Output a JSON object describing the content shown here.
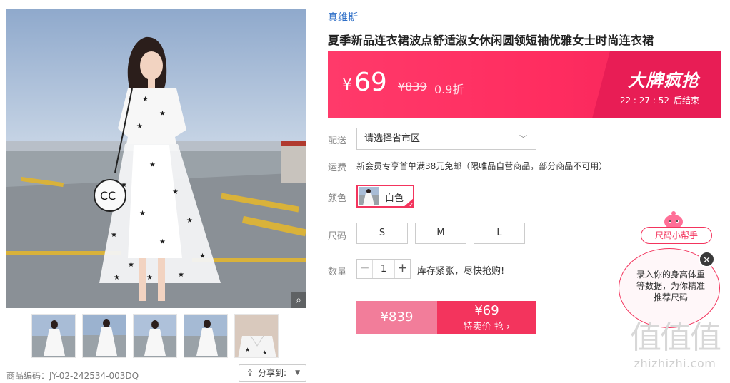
{
  "product": {
    "brand": "真维斯",
    "title": "夏季新品连衣裙波点舒适淑女休闲圆领短袖优雅女士时尚连衣裙",
    "sku_line": "商品编码：JY-02-242534-003DQ",
    "share_label": "分享到:",
    "zoom_icon": "magnifier-icon"
  },
  "thumbnails": [
    {
      "label": "thumb-1"
    },
    {
      "label": "thumb-2"
    },
    {
      "label": "thumb-3"
    },
    {
      "label": "thumb-4"
    },
    {
      "label": "thumb-5"
    }
  ],
  "price": {
    "currency": "¥",
    "current": "69",
    "original": "¥839",
    "discount": "0.9折"
  },
  "promo": {
    "title": "大牌疯抢",
    "countdown": "22 : 27 : 52",
    "ends_label": "后结束"
  },
  "delivery": {
    "label": "配送",
    "placeholder": "请选择省市区"
  },
  "shipping": {
    "label": "运费",
    "text": "新会员专享首单满38元免邮（限唯品自营商品，部分商品不可用）"
  },
  "color": {
    "label": "颜色",
    "selected": "白色"
  },
  "size": {
    "label": "尺码",
    "options": [
      "S",
      "M",
      "L"
    ]
  },
  "quantity": {
    "label": "数量",
    "value": "1",
    "minus": "−",
    "plus": "+",
    "stock_tip": "库存紧张，尽快抢购!"
  },
  "buy": {
    "original": "¥839",
    "price": "¥69",
    "action": "特卖价 抢 ›"
  },
  "helper": {
    "button": "尺码小帮手",
    "bubble": "录入你的身高体重等数据，为你精准推荐尺码",
    "close": "✕"
  },
  "watermark": {
    "logo": "值值值",
    "url": "zhizhizhi.com"
  },
  "colors": {
    "accent": "#f3345d",
    "banner": "#ff3a6a",
    "brand_link": "#2f6fc7"
  }
}
